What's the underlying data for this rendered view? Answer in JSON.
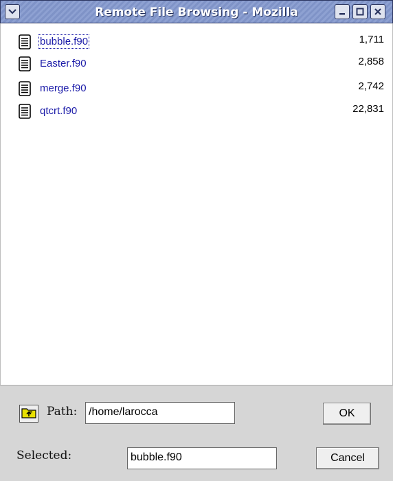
{
  "window": {
    "title": "Remote File Browsing - Mozilla",
    "menu_icon": "chevron-down-icon",
    "controls": [
      "minimize-icon",
      "maximize-icon",
      "close-icon"
    ]
  },
  "files": [
    {
      "name": "bubble.f90",
      "size": "1,711",
      "selected": true
    },
    {
      "name": "Easter.f90",
      "size": "2,858",
      "selected": false
    },
    {
      "name": "merge.f90",
      "size": "2,742",
      "selected": false
    },
    {
      "name": "qtcrt.f90",
      "size": "22,831",
      "selected": false
    }
  ],
  "footer": {
    "up_folder_icon": "folder-up-icon",
    "path_label": "Path:",
    "path_value": "/home/larocca",
    "selected_label": "Selected:",
    "selected_value": "bubble.f90",
    "ok_label": "OK",
    "cancel_label": "Cancel"
  },
  "colors": {
    "titlebar": "#8a9dcf",
    "link": "#1a1aa8",
    "panel": "#d6d6d6"
  }
}
